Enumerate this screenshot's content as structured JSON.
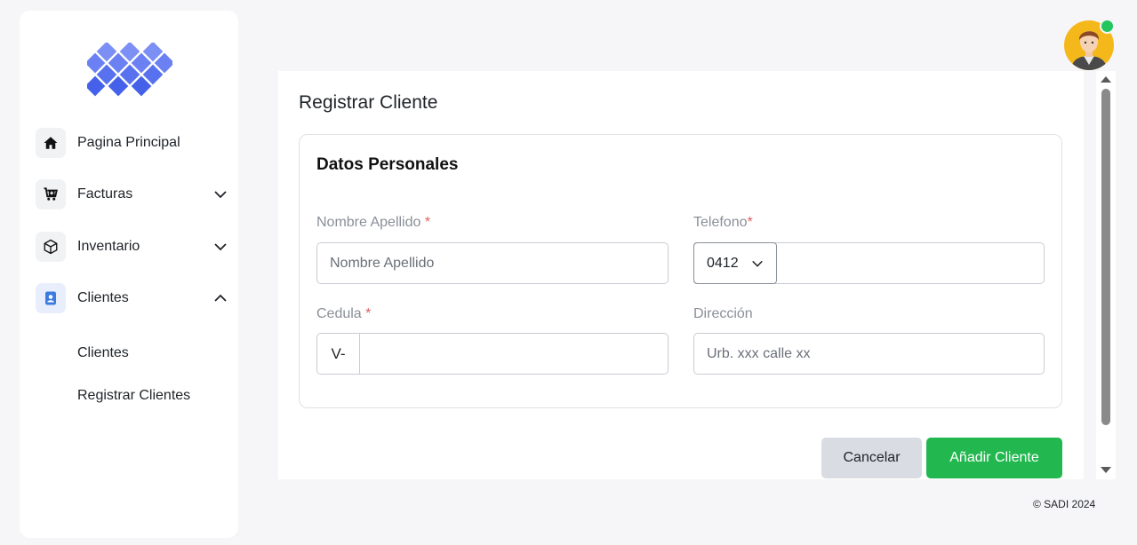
{
  "sidebar": {
    "items": [
      {
        "label": "Pagina Principal",
        "icon": "home-icon"
      },
      {
        "label": "Facturas",
        "icon": "cart-icon"
      },
      {
        "label": "Inventario",
        "icon": "box-icon"
      },
      {
        "label": "Clientes",
        "icon": "contact-icon"
      }
    ],
    "subitems": [
      {
        "label": "Clientes"
      },
      {
        "label": "Registrar Clientes"
      }
    ]
  },
  "page": {
    "title": "Registrar Cliente",
    "section_title": "Datos Personales"
  },
  "form": {
    "nombre": {
      "label": "Nombre Apellido",
      "required": "*",
      "placeholder": "Nombre Apellido"
    },
    "telefono": {
      "label": "Telefono",
      "required": "*",
      "prefix_value": "0412",
      "value": ""
    },
    "cedula": {
      "label": "Cedula",
      "required": "*",
      "prefix": "V-",
      "value": ""
    },
    "direccion": {
      "label": "Dirección",
      "placeholder": "Urb. xxx calle xx"
    }
  },
  "buttons": {
    "cancel": "Cancelar",
    "add": "Añadir Cliente"
  },
  "footer": {
    "copyright": "© SADI 2024"
  },
  "colors": {
    "accent_green": "#22b84f",
    "logo_blue": "#4f6af0",
    "online": "#22c55e"
  }
}
